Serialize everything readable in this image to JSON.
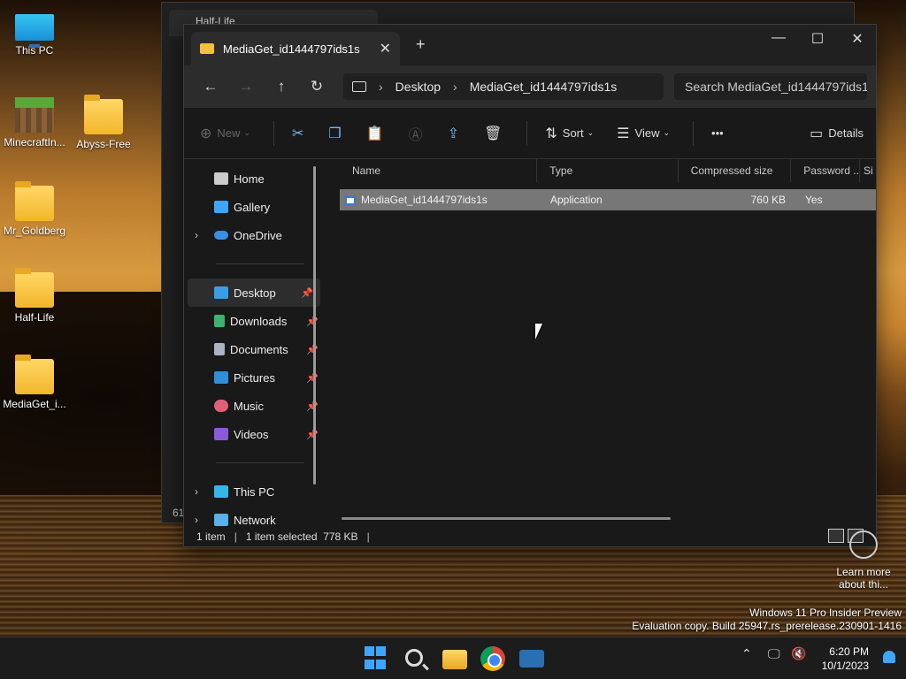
{
  "desktop": {
    "icons": [
      {
        "label": "This PC"
      },
      {
        "label": "MinecraftIn..."
      },
      {
        "label": "Abyss-Free"
      },
      {
        "label": "Mr_Goldberg"
      },
      {
        "label": "Half-Life"
      },
      {
        "label": "MediaGet_i..."
      }
    ],
    "learn_more": "Learn more about thi...",
    "watermark_line1": "Windows 11 Pro Insider Preview",
    "watermark_line2": "Evaluation copy. Build 25947.rs_prerelease.230901-1416"
  },
  "back_window": {
    "tab_title": "Half-Life",
    "status_fragment": "61"
  },
  "window": {
    "tab_title": "MediaGet_id1444797ids1s",
    "breadcrumb": [
      "Desktop",
      "MediaGet_id1444797ids1s"
    ],
    "search_placeholder": "Search MediaGet_id1444797ids1s",
    "toolbar": {
      "new": "New",
      "sort": "Sort",
      "view": "View",
      "more": "•••",
      "details": "Details"
    },
    "nav": {
      "home": "Home",
      "gallery": "Gallery",
      "onedrive": "OneDrive",
      "desktop": "Desktop",
      "downloads": "Downloads",
      "documents": "Documents",
      "pictures": "Pictures",
      "music": "Music",
      "videos": "Videos",
      "this_pc": "This PC",
      "network": "Network"
    },
    "columns": [
      "Name",
      "Type",
      "Compressed size",
      "Password ...",
      "Si"
    ],
    "rows": [
      {
        "name": "MediaGet_id1444797ids1s",
        "type": "Application",
        "compressed_size": "760 KB",
        "password": "Yes"
      }
    ],
    "status": {
      "items": "1 item",
      "selected": "1 item selected  778 KB"
    }
  },
  "taskbar": {
    "time": "6:20 PM",
    "date": "10/1/2023"
  },
  "colors": {
    "accent": "#3ea6ff",
    "selection": "#777777",
    "window_bg": "#191919"
  }
}
